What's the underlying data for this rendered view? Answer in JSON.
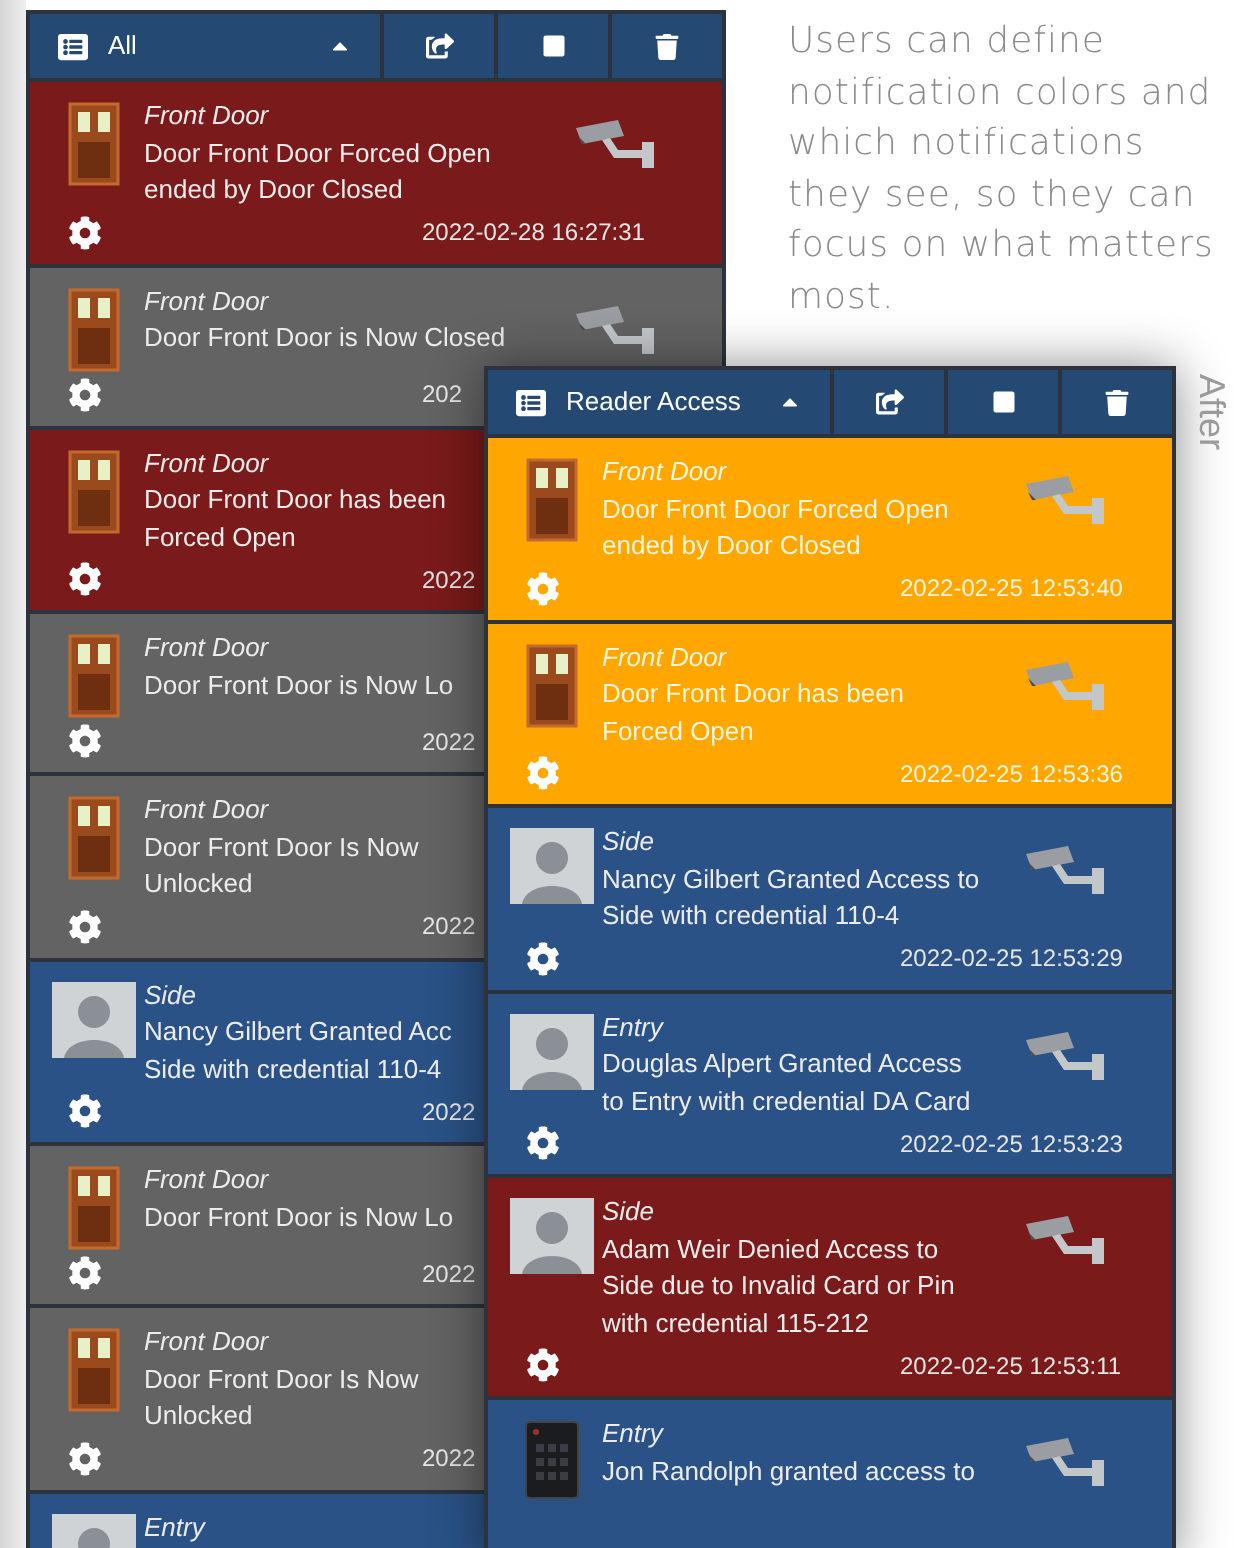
{
  "caption": "Users can define notification colors and which notifications they see, so they can focus on what matters most.",
  "side_label": "After",
  "panels": [
    {
      "filter": "All",
      "rows": [
        {
          "kind": "door",
          "color": "#7a1a1a",
          "camera": true,
          "location": "Front Door",
          "lines": [
            "Door Front Door Forced Open",
            "ended by Door Closed"
          ],
          "time": "2022-02-28 16:27:31"
        },
        {
          "kind": "door",
          "color": "#636363",
          "camera": true,
          "location": "Front Door",
          "lines": [
            "Door Front Door is Now Closed"
          ],
          "time": "202"
        },
        {
          "kind": "door",
          "color": "#7a1a1a",
          "camera": false,
          "location": "Front Door",
          "lines": [
            "Door Front Door has been",
            "Forced Open"
          ],
          "time": "2022"
        },
        {
          "kind": "door",
          "color": "#636363",
          "camera": false,
          "location": "Front Door",
          "lines": [
            "Door Front Door is Now Lo"
          ],
          "time": "2022"
        },
        {
          "kind": "door",
          "color": "#636363",
          "camera": false,
          "location": "Front Door",
          "lines": [
            "Door Front Door Is Now",
            "Unlocked"
          ],
          "time": "2022"
        },
        {
          "kind": "person",
          "color": "#2a5286",
          "camera": false,
          "location": "Side",
          "lines": [
            "Nancy Gilbert Granted Acc",
            "Side with credential 110-4"
          ],
          "time": "2022"
        },
        {
          "kind": "door",
          "color": "#636363",
          "camera": false,
          "location": "Front Door",
          "lines": [
            "Door Front Door is Now Lo"
          ],
          "time": "2022"
        },
        {
          "kind": "door",
          "color": "#636363",
          "camera": false,
          "location": "Front Door",
          "lines": [
            "Door Front Door Is Now",
            "Unlocked"
          ],
          "time": "2022"
        },
        {
          "kind": "person",
          "color": "#2a5286",
          "camera": false,
          "location": "Entry",
          "lines": []
        }
      ]
    },
    {
      "filter": "Reader Access",
      "rows": [
        {
          "kind": "door",
          "color": "#ffa600",
          "camera": true,
          "location": "Front Door",
          "lines": [
            "Door Front Door Forced Open",
            "ended by Door Closed"
          ],
          "time": "2022-02-25 12:53:40"
        },
        {
          "kind": "door",
          "color": "#ffa600",
          "camera": true,
          "location": "Front Door",
          "lines": [
            "Door Front Door has been",
            "Forced Open"
          ],
          "time": "2022-02-25 12:53:36"
        },
        {
          "kind": "person",
          "color": "#2a5286",
          "camera": true,
          "location": "Side",
          "lines": [
            "Nancy Gilbert Granted Access to",
            "Side with credential 110-4"
          ],
          "time": "2022-02-25 12:53:29"
        },
        {
          "kind": "person",
          "color": "#2a5286",
          "camera": true,
          "location": "Entry",
          "lines": [
            "Douglas Alpert Granted Access",
            "to Entry with credential DA Card"
          ],
          "time": "2022-02-25 12:53:23"
        },
        {
          "kind": "person",
          "color": "#7a1a1a",
          "camera": true,
          "location": "Side",
          "lines": [
            "Adam Weir Denied Access to",
            "Side due to Invalid Card or Pin",
            "with credential 115-212"
          ],
          "time": "2022-02-25 12:53:11"
        },
        {
          "kind": "reader",
          "color": "#2a5286",
          "camera": true,
          "location": "Entry",
          "lines": [
            "Jon Randolph granted access to"
          ]
        }
      ]
    }
  ]
}
